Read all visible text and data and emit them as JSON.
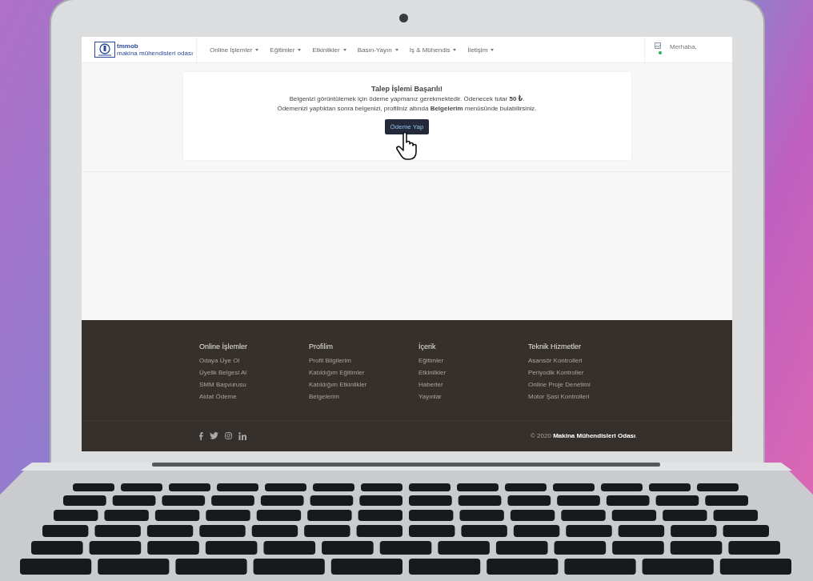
{
  "logo": {
    "line_1": "tmmob",
    "line_2": "makina mühendisleri odası"
  },
  "nav": [
    {
      "label": "Online İşlemler",
      "dropdown": true
    },
    {
      "label": "Eğitimler",
      "dropdown": true
    },
    {
      "label": "Etkinlikler",
      "dropdown": true
    },
    {
      "label": "Basın-Yayın",
      "dropdown": true
    },
    {
      "label": "İş & Mühendis",
      "dropdown": true
    },
    {
      "label": "İletişim",
      "dropdown": true
    }
  ],
  "user": {
    "greeting": "Merhaba,",
    "online": true
  },
  "message": {
    "title": "Talep İşlemi Başarılı!",
    "lines": [
      "Belgenizi görüntülemek için ödeme yapmanız gerekmektedir. Ödenecek tutar **50 ₺**.",
      "Ödemenizi yaptıktan sonra belgenizi, profiliniz altında **Belgelerim** menüsünde bulabilirsiniz."
    ],
    "button": "Ödeme Yap"
  },
  "footer": {
    "columns": [
      {
        "title": "Online İşlemler",
        "links": [
          "Odaya Üye Ol",
          "Üyelik Belgesi Al",
          "SMM Başvurusu",
          "Aidat Ödeme"
        ]
      },
      {
        "title": "Profilim",
        "links": [
          "Profil Bilgilerim",
          "Katıldığım Eğitimler",
          "Katıldığım Etkinlikler",
          "Belgelerim"
        ]
      },
      {
        "title": "İçerik",
        "links": [
          "Eğitimler",
          "Etkinlikler",
          "Haberler",
          "Yayınlar"
        ]
      },
      {
        "title": "Teknik Hizmetler",
        "links": [
          "Asansör Kontrolleri",
          "Periyodik Kontroller",
          "Online Proje Denetimi",
          "Motor Şasi Kontrolleri"
        ]
      }
    ],
    "copyright": "© 2020 **Makina Mühendisleri Odası**."
  }
}
